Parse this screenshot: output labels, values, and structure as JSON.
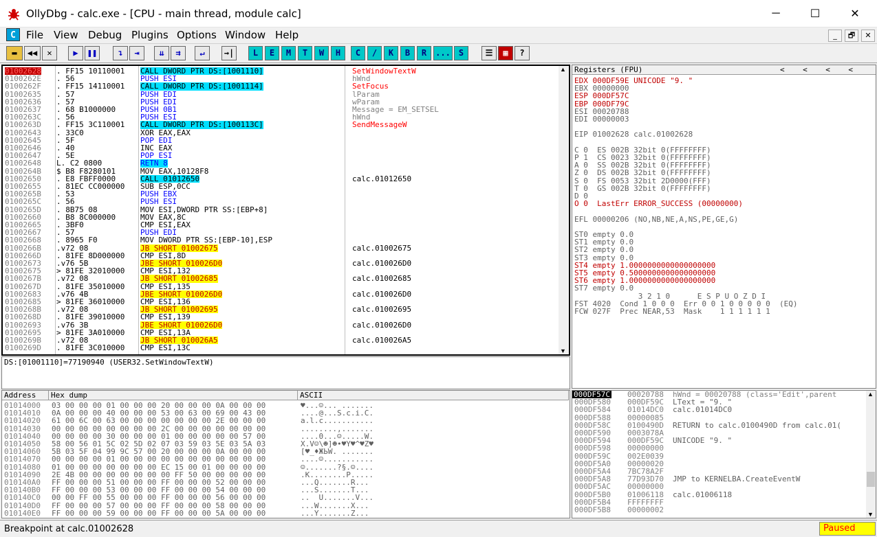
{
  "window": {
    "title": "OllyDbg - calc.exe - [CPU - main thread, module calc]",
    "minimize": "─",
    "maximize": "☐",
    "close": "✕"
  },
  "menu": {
    "items": [
      "File",
      "View",
      "Debug",
      "Plugins",
      "Options",
      "Window",
      "Help"
    ],
    "mdi": [
      "_",
      "🗗",
      "✕"
    ],
    "icon_letter": "C"
  },
  "toolbar": {
    "letters": [
      "L",
      "E",
      "M",
      "T",
      "W",
      "H",
      "C",
      "/",
      "K",
      "B",
      "R",
      "...",
      "S"
    ]
  },
  "disasm": [
    {
      "a": "01002628",
      "h": ". FF15 10110001",
      "d": "CALL DWORD PTR DS:[1001110]",
      "c": "SetWindowTextW",
      "sel": true
    },
    {
      "a": "0100262E",
      "h": ". 56",
      "d": "PUSH ESI",
      "c": "hWnd"
    },
    {
      "a": "0100262F",
      "h": ". FF15 14110001",
      "d": "CALL DWORD PTR DS:[1001114]",
      "c": "SetFocus"
    },
    {
      "a": "01002635",
      "h": ". 57",
      "d": "PUSH EDI",
      "c": "lParam"
    },
    {
      "a": "01002636",
      "h": ". 57",
      "d": "PUSH EDI",
      "c": "wParam"
    },
    {
      "a": "01002637",
      "h": ". 68 B1000000",
      "d": "PUSH 0B1",
      "c": "Message = EM_SETSEL"
    },
    {
      "a": "0100263C",
      "h": ". 56",
      "d": "PUSH ESI",
      "c": "hWnd"
    },
    {
      "a": "0100263D",
      "h": ". FF15 3C110001",
      "d": "CALL DWORD PTR DS:[100113C]",
      "c": "SendMessageW"
    },
    {
      "a": "01002643",
      "h": ". 33C0",
      "d": "XOR EAX,EAX",
      "c": ""
    },
    {
      "a": "01002645",
      "h": ". 5F",
      "d": "POP EDI",
      "c": ""
    },
    {
      "a": "01002646",
      "h": ". 40",
      "d": "INC EAX",
      "c": ""
    },
    {
      "a": "01002647",
      "h": ". 5E",
      "d": "POP ESI",
      "c": ""
    },
    {
      "a": "01002648",
      "h": "L. C2 0800",
      "d": "RETN 8",
      "c": ""
    },
    {
      "a": "0100264B",
      "h": "$ B8 F8280101",
      "d": "MOV EAX,10128F8",
      "c": ""
    },
    {
      "a": "01002650",
      "h": ". E8 FBFF0000",
      "d": "CALL 01012650",
      "c": "calc.01012650"
    },
    {
      "a": "01002655",
      "h": ". 81EC CC000000",
      "d": "SUB ESP,0CC",
      "c": ""
    },
    {
      "a": "0100265B",
      "h": ". 53",
      "d": "PUSH EBX",
      "c": ""
    },
    {
      "a": "0100265C",
      "h": ". 56",
      "d": "PUSH ESI",
      "c": ""
    },
    {
      "a": "0100265D",
      "h": ". 8B75 08",
      "d": "MOV ESI,DWORD PTR SS:[EBP+8]",
      "c": ""
    },
    {
      "a": "01002660",
      "h": ". B8 8C000000",
      "d": "MOV EAX,8C",
      "c": ""
    },
    {
      "a": "01002665",
      "h": ". 3BF0",
      "d": "CMP ESI,EAX",
      "c": ""
    },
    {
      "a": "01002667",
      "h": ". 57",
      "d": "PUSH EDI",
      "c": ""
    },
    {
      "a": "01002668",
      "h": ". 8965 F0",
      "d": "MOV DWORD PTR SS:[EBP-10],ESP",
      "c": ""
    },
    {
      "a": "0100266B",
      "h": ".v72 08",
      "d": "JB SHORT 01002675",
      "c": "calc.01002675"
    },
    {
      "a": "0100266D",
      "h": ". 81FE 8D000000",
      "d": "CMP ESI,8D",
      "c": ""
    },
    {
      "a": "01002673",
      "h": ".v76 5B",
      "d": "JBE SHORT 010026D0",
      "c": "calc.010026D0"
    },
    {
      "a": "01002675",
      "h": "> 81FE 32010000",
      "d": "CMP ESI,132",
      "c": ""
    },
    {
      "a": "0100267B",
      "h": ".v72 08",
      "d": "JB SHORT 01002685",
      "c": "calc.01002685"
    },
    {
      "a": "0100267D",
      "h": ". 81FE 35010000",
      "d": "CMP ESI,135",
      "c": ""
    },
    {
      "a": "01002683",
      "h": ".v76 4B",
      "d": "JBE SHORT 010026D0",
      "c": "calc.010026D0"
    },
    {
      "a": "01002685",
      "h": "> 81FE 36010000",
      "d": "CMP ESI,136",
      "c": ""
    },
    {
      "a": "0100268B",
      "h": ".v72 08",
      "d": "JB SHORT 01002695",
      "c": "calc.01002695"
    },
    {
      "a": "0100268D",
      "h": ". 81FE 39010000",
      "d": "CMP ESI,139",
      "c": ""
    },
    {
      "a": "01002693",
      "h": ".v76 3B",
      "d": "JBE SHORT 010026D0",
      "c": "calc.010026D0"
    },
    {
      "a": "01002695",
      "h": "> 81FE 3A010000",
      "d": "CMP ESI,13A",
      "c": ""
    },
    {
      "a": "0100269B",
      "h": ".v72 08",
      "d": "JB SHORT 010026A5",
      "c": "calc.010026A5"
    },
    {
      "a": "0100269D",
      "h": ". 81FE 3C010000",
      "d": "CMP ESI,13C",
      "c": ""
    }
  ],
  "info": "DS:[01001110]=77190940 (USER32.SetWindowTextW)",
  "registers": {
    "header": "Registers (FPU)",
    "arrows": "<    <    <    <",
    "lines": [
      "EDX 000DF59E UNICODE \"9. \"",
      "EBX 00000000",
      "ESP 000DF57C",
      "EBP 000DF79C",
      "ESI 00020788",
      "EDI 00000003",
      "",
      "EIP 01002628 calc.01002628",
      "",
      "C 0  ES 002B 32bit 0(FFFFFFFF)",
      "P 1  CS 0023 32bit 0(FFFFFFFF)",
      "A 0  SS 002B 32bit 0(FFFFFFFF)",
      "Z 0  DS 002B 32bit 0(FFFFFFFF)",
      "S 0  FS 0053 32bit 2D0000(FFF)",
      "T 0  GS 002B 32bit 0(FFFFFFFF)",
      "D 0",
      "O 0  LastErr ERROR_SUCCESS (00000000)",
      "",
      "EFL 00000206 (NO,NB,NE,A,NS,PE,GE,G)",
      "",
      "ST0 empty 0.0",
      "ST1 empty 0.0",
      "ST2 empty 0.0",
      "ST3 empty 0.0",
      "ST4 empty 1.0000000000000000000",
      "ST5 empty 0.5000000000000000000",
      "ST6 empty 1.0000000000000000000",
      "ST7 empty 0.0",
      "              3 2 1 0      E S P U O Z D I",
      "FST 4020  Cond 1 0 0 0  Err 0 0 1 0 0 0 0 0  (EQ)",
      "FCW 027F  Prec NEAR,53  Mask    1 1 1 1 1 1"
    ]
  },
  "dump": {
    "h_addr": "Address",
    "h_hex": "Hex dump",
    "h_ascii": "ASCII",
    "rows": [
      [
        "01014000",
        "03 00 00 00 01 00 00 00 20 00 00 00 0A 00 00 00",
        "♥...☺... ......."
      ],
      [
        "01014010",
        "0A 00 00 00 40 00 00 00 53 00 63 00 69 00 43 00",
        "....@...S.c.i.C."
      ],
      [
        "01014020",
        "61 00 6C 00 63 00 00 00 00 00 00 00 2E 00 00 00",
        "a.l.c..........."
      ],
      [
        "01014030",
        "00 00 00 00 00 00 00 00 2C 00 00 00 00 00 00 00",
        "........,......."
      ],
      [
        "01014040",
        "00 00 00 00 30 00 00 00 01 00 00 00 00 00 57 00",
        "....0...☺.....W."
      ],
      [
        "01014050",
        "58 00 56 01 5C 02 5D 02 07 03 59 03 5E 03 5A 03",
        "X.V☺\\☻]☻•♥Y♥^♥Z♥"
      ],
      [
        "01014060",
        "5B 03 5F 04 99 9C 57 00 20 00 00 00 0A 00 00 00",
        "[♥_♦ЖЬW. ......."
      ],
      [
        "01014070",
        "00 00 00 00 01 00 00 00 00 00 00 00 00 00 00 00",
        "....☺..........."
      ],
      [
        "01014080",
        "01 00 00 00 00 00 00 00 EC 15 00 01 00 00 00 00",
        "☺.......?§.☺...."
      ],
      [
        "01014090",
        "2E 4B 00 00 00 00 00 00 00 FF 50 00 00 00 00 00",
        ".K........P....."
      ],
      [
        "010140A0",
        "FF 00 00 00 51 00 00 00 FF 00 00 00 52 00 00 00",
        "...Q.......R..."
      ],
      [
        "010140B0",
        "FF 00 00 00 53 00 00 00 FF 00 00 00 54 00 00 00",
        "...S.......T..."
      ],
      [
        "010140C0",
        "00 00 FF 00 55 00 00 00 FF 00 00 00 56 00 00 00",
        "..  U.......V..."
      ],
      [
        "010140D0",
        "FF 00 00 00 57 00 00 00 FF 00 00 00 58 00 00 00",
        "...W.......X..."
      ],
      [
        "010140E0",
        "FF 00 00 00 59 00 00 00 FF 00 00 00 5A 00 00 00",
        "...Y.......Z..."
      ]
    ]
  },
  "stack": {
    "top": "000DF57C",
    "top_val": "00020788",
    "top_cmt": "hWnd = 00020788 (class='Edit',parent",
    "rows": [
      [
        "000DF580",
        "000DF59C",
        "LText = \"9. \""
      ],
      [
        "000DF584",
        "01014DC0",
        "calc.01014DC0"
      ],
      [
        "000DF588",
        "00000085",
        ""
      ],
      [
        "000DF58C",
        "0100490D",
        "RETURN to calc.0100490D from calc.01("
      ],
      [
        "000DF590",
        "0003078A",
        ""
      ],
      [
        "000DF594",
        "000DF59C",
        "UNICODE \"9. \""
      ],
      [
        "000DF598",
        "00000000",
        ""
      ],
      [
        "000DF59C",
        "002E0039",
        ""
      ],
      [
        "000DF5A0",
        "00000020",
        ""
      ],
      [
        "000DF5A4",
        "7BC78A2F",
        ""
      ],
      [
        "000DF5A8",
        "77D93D70",
        "JMP to KERNELBA.CreateEventW"
      ],
      [
        "000DF5AC",
        "00000000",
        ""
      ],
      [
        "000DF5B0",
        "01006118",
        "calc.01006118"
      ],
      [
        "000DF5B4",
        "FFFFFFFF",
        ""
      ],
      [
        "000DF5B8",
        "00000002",
        ""
      ]
    ]
  },
  "status": {
    "text": "Breakpoint at calc.01002628",
    "state": "Paused"
  }
}
